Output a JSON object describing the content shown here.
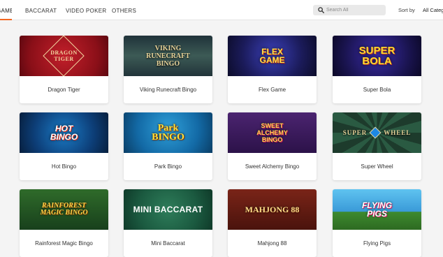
{
  "tabs": [
    {
      "label": "GAMES",
      "active": true
    },
    {
      "label": "BACCARAT",
      "active": false
    },
    {
      "label": "VIDEO POKER",
      "active": false
    },
    {
      "label": "OTHERS",
      "active": false
    }
  ],
  "search": {
    "placeholder": "Search All",
    "icon": "search-icon"
  },
  "sort": {
    "label": "Sort by",
    "value": "All Categories"
  },
  "colors": {
    "accent": "#f26822",
    "background": "#f4f4f4",
    "card": "#ffffff"
  },
  "games": [
    {
      "title": "Dragon Tiger",
      "art_text": "DRAGON TIGER"
    },
    {
      "title": "Viking Runecraft Bingo",
      "art_text": "VIKING RUNECRAFT BINGO"
    },
    {
      "title": "Flex Game",
      "art_text": "FLEX GAME"
    },
    {
      "title": "Super Bola",
      "art_text": "SUPER BOLA"
    },
    {
      "title": "Hot Bingo",
      "art_text": "HOT BINGO"
    },
    {
      "title": "Park Bingo",
      "art_text": "Park BINGO"
    },
    {
      "title": "Sweet Alchemy Bingo",
      "art_text": "SWEET ALCHEMY BINGO"
    },
    {
      "title": "Super Wheel",
      "art_text_left": "SUPER",
      "art_text_right": "WHEEL"
    },
    {
      "title": "Rainforest Magic Bingo",
      "art_text": "RAINFOREST MAGIC BINGO"
    },
    {
      "title": "Mini Baccarat",
      "art_text": "MINI BACCARAT"
    },
    {
      "title": "Mahjong 88",
      "art_text": "MAHJONG 88"
    },
    {
      "title": "Flying Pigs",
      "art_text": "FLYING PIGS"
    }
  ]
}
